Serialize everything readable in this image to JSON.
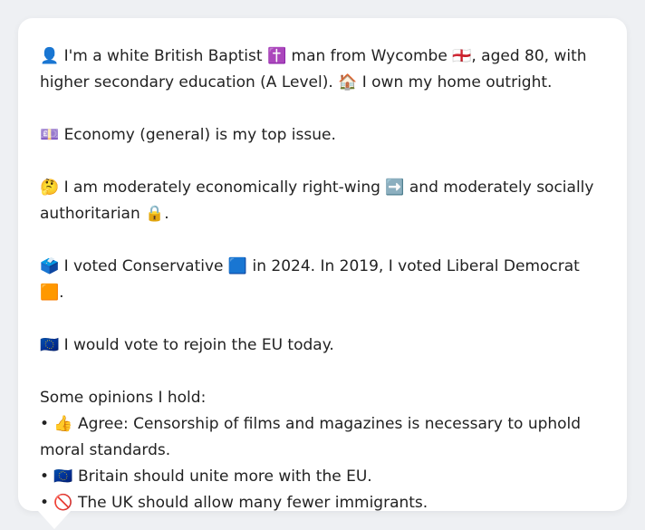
{
  "profile": {
    "paragraphs": [
      "👤 I'm a white British Baptist ✝️ man from Wycombe 🏴󠁧󠁢󠁥󠁮󠁧󠁿, aged 80, with higher secondary education (A Level). 🏠 I own my home outright.",
      "💷 Economy (general) is my top issue.",
      "🤔 I am moderately economically right-wing ➡️ and moderately socially authoritarian 🔒.",
      "🗳️ I voted Conservative 🟦 in 2024. In 2019, I voted Liberal Democrat 🟧.",
      "🇪🇺 I would vote to rejoin the EU today."
    ],
    "opinions_heading": "Some opinions I hold:",
    "opinions": [
      "• 👍 Agree: Censorship of films and magazines is necessary to uphold moral standards.",
      "• 🇪🇺 Britain should unite more with the EU.",
      "• 🚫 The UK should allow many fewer immigrants."
    ]
  }
}
